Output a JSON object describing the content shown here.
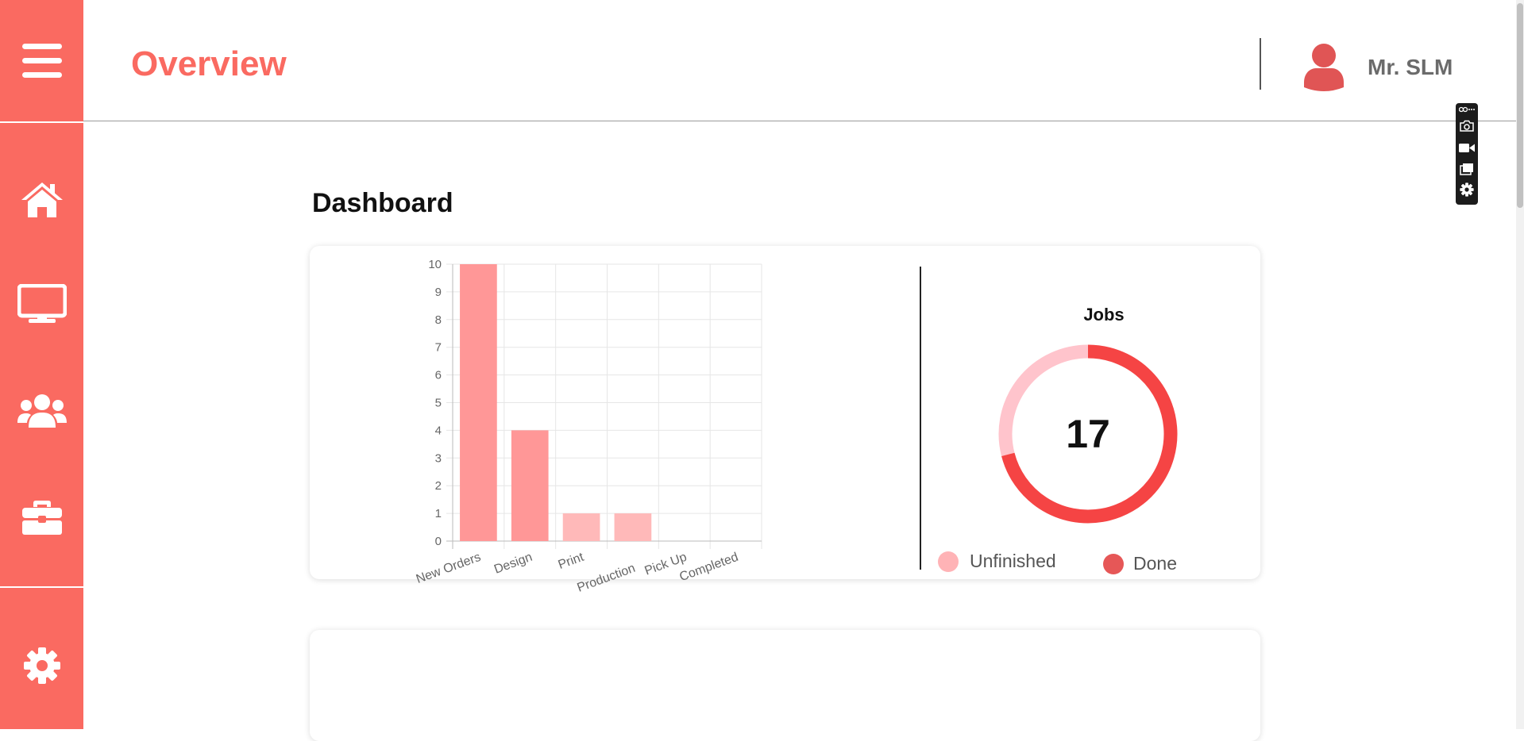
{
  "header": {
    "title": "Overview",
    "user_name": "Mr. SLM"
  },
  "sidebar": {
    "items": [
      {
        "name": "home",
        "icon": "home-icon"
      },
      {
        "name": "monitor",
        "icon": "monitor-icon"
      },
      {
        "name": "users",
        "icon": "users-icon"
      },
      {
        "name": "briefcase",
        "icon": "briefcase-icon"
      },
      {
        "name": "settings",
        "icon": "gear-icon"
      }
    ]
  },
  "main": {
    "section_title": "Dashboard"
  },
  "colors": {
    "accent": "#fa6a61",
    "bar_strong": "#ff9797",
    "bar_light": "#ffb9b9",
    "donut_done": "#f54444",
    "donut_unfinished": "#ffc4cc",
    "legend_unfinished": "#ffb3b6",
    "legend_done": "#e65757"
  },
  "chart_data": [
    {
      "type": "bar",
      "categories": [
        "New Orders",
        "Design",
        "Print",
        "Production",
        "Pick Up",
        "Completed"
      ],
      "values": [
        10,
        4,
        1,
        1,
        0,
        0
      ],
      "ylim": [
        0,
        10
      ],
      "yticks": [
        "0",
        "1",
        "2",
        "3",
        "4",
        "5",
        "6",
        "7",
        "8",
        "9",
        "10"
      ],
      "grid": true
    },
    {
      "type": "pie",
      "title": "Jobs",
      "center_label": "17",
      "series": [
        {
          "name": "Unfinished",
          "value": 0.29
        },
        {
          "name": "Done",
          "value": 0.71
        }
      ],
      "legend_position": "bottom"
    }
  ]
}
